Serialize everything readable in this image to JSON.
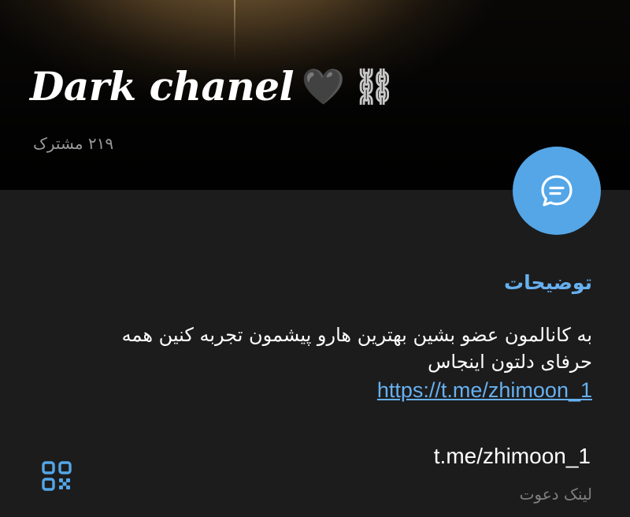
{
  "header": {
    "title": "Dark chanel",
    "emoji_heart": "🖤",
    "emoji_chains": "⛓",
    "subscribers": "۲۱۹ مشترک"
  },
  "fab": {
    "icon": "message-bubble-icon"
  },
  "info": {
    "section_label": "توضیحات",
    "description_line1": "به کانالمون عضو بشین بهترین هارو پیشمون تجربه کنین همه",
    "description_line2": "حرفای دلتون اینجاس",
    "description_link": "https://t.me/zhimoon_1",
    "invite_link": "t.me/zhimoon_1",
    "invite_label": "لینک دعوت",
    "qr_icon": "qr-code-icon"
  },
  "colors": {
    "accent": "#54a6e7",
    "link": "#67b0ef",
    "background": "#1c1c1d",
    "secondary_text": "#7f7f80"
  }
}
